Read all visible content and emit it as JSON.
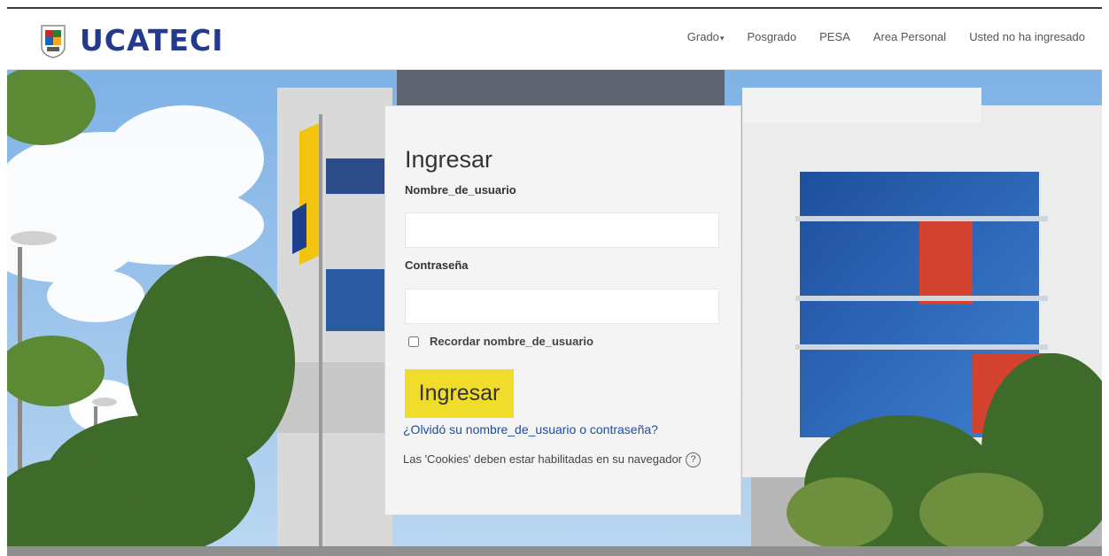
{
  "brand": {
    "name": "UCATECI"
  },
  "nav": {
    "items": [
      {
        "label": "Grado",
        "has_dropdown": true
      },
      {
        "label": "Posgrado"
      },
      {
        "label": "PESA"
      },
      {
        "label": "Area Personal"
      },
      {
        "label": "Usted no ha ingresado"
      }
    ],
    "dropdown_caret": "▾"
  },
  "login": {
    "title": "Ingresar",
    "username_label": "Nombre_de_usuario",
    "username_value": "",
    "password_label": "Contraseña",
    "password_value": "",
    "remember_label": "Recordar nombre_de_usuario",
    "remember_checked": false,
    "submit_label": "Ingresar",
    "forgot_link": "¿Olvidó su nombre_de_usuario o contraseña?",
    "cookies_notice": "Las 'Cookies' deben estar habilitadas en su navegador",
    "help_glyph": "?"
  },
  "colors": {
    "brand_blue": "#243a8c",
    "submit_yellow": "#f0dc2b",
    "link_blue": "#1a4fa0",
    "card_bg": "#f4f4f4"
  }
}
